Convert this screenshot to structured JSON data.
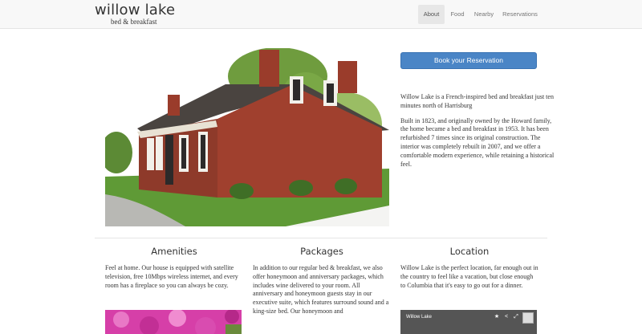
{
  "brand": {
    "title": "willow lake",
    "subtitle": "bed & breakfast"
  },
  "nav": {
    "items": [
      "About",
      "Food",
      "Nearby",
      "Reservations"
    ],
    "active": "About"
  },
  "hero": {
    "book_button": "Book your Reservation"
  },
  "intro": {
    "p1": "Willow Lake is a French-inspired bed and breakfast just ten minutes north of Harrisburg",
    "p2": "Built in 1823, and originally owned by the Howard family, the home became a bed and breakfast in 1953. It has been refurbished 7 times since its original construction. The interior was completely rebuilt in 2007, and we offer a comfortable modern experience, while retaining a historical feel."
  },
  "sections": [
    {
      "title": "Amenities",
      "text": "Feel at home. Our house is equipped with satellite television, free 10Mbps wireless internet, and every room has a fireplace so you can always be cozy."
    },
    {
      "title": "Packages",
      "text": "In addition to our regular bed & breakfast, we also offer honeymoon and anniversary packages, which includes wine delivered to your room. All anniversary and honeymoon guests stay in our executive suite, which features surround sound and a king-size bed. Our honeymoon and"
    },
    {
      "title": "Location",
      "text": "Willow Lake is the perfect location, far enough out in the country to feel like a vacation, but close enough to Columbia that it's easy to go out for a dinner."
    }
  ],
  "map": {
    "title": "Willow Lake",
    "icons": [
      "star-icon",
      "share-icon",
      "expand-icon",
      "map-thumb-icon"
    ]
  },
  "colors": {
    "primary": "#4a85c6",
    "navbar_bg": "#f8f8f8",
    "brick": "#a0402e",
    "grass": "#5f9a36"
  }
}
